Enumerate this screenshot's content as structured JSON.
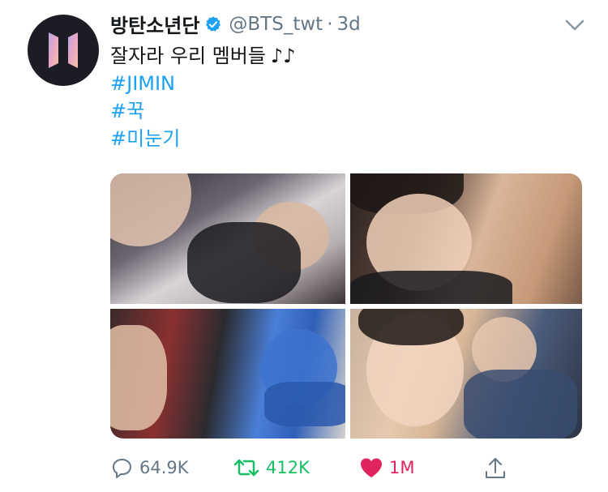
{
  "tweet": {
    "author_name": "방탄소년단",
    "handle": "@BTS_twt",
    "separator": "·",
    "time": "3d",
    "text_line1": "잘자라 우리 멤버들",
    "music_notes": "♪♪",
    "hashtags": [
      "#JIMIN",
      "#꾹",
      "#미눈기"
    ]
  },
  "actions": {
    "reply_count": "64.9K",
    "retweet_count": "412K",
    "like_count": "1M"
  },
  "colors": {
    "accent": "#1da1f2",
    "verified": "#1da1f2",
    "retweet": "#17bf63",
    "like": "#e0245e",
    "secondary_text": "#657786"
  },
  "icons": [
    "verified-badge-icon",
    "chevron-down-icon",
    "reply-icon",
    "retweet-icon",
    "heart-icon",
    "share-icon"
  ]
}
